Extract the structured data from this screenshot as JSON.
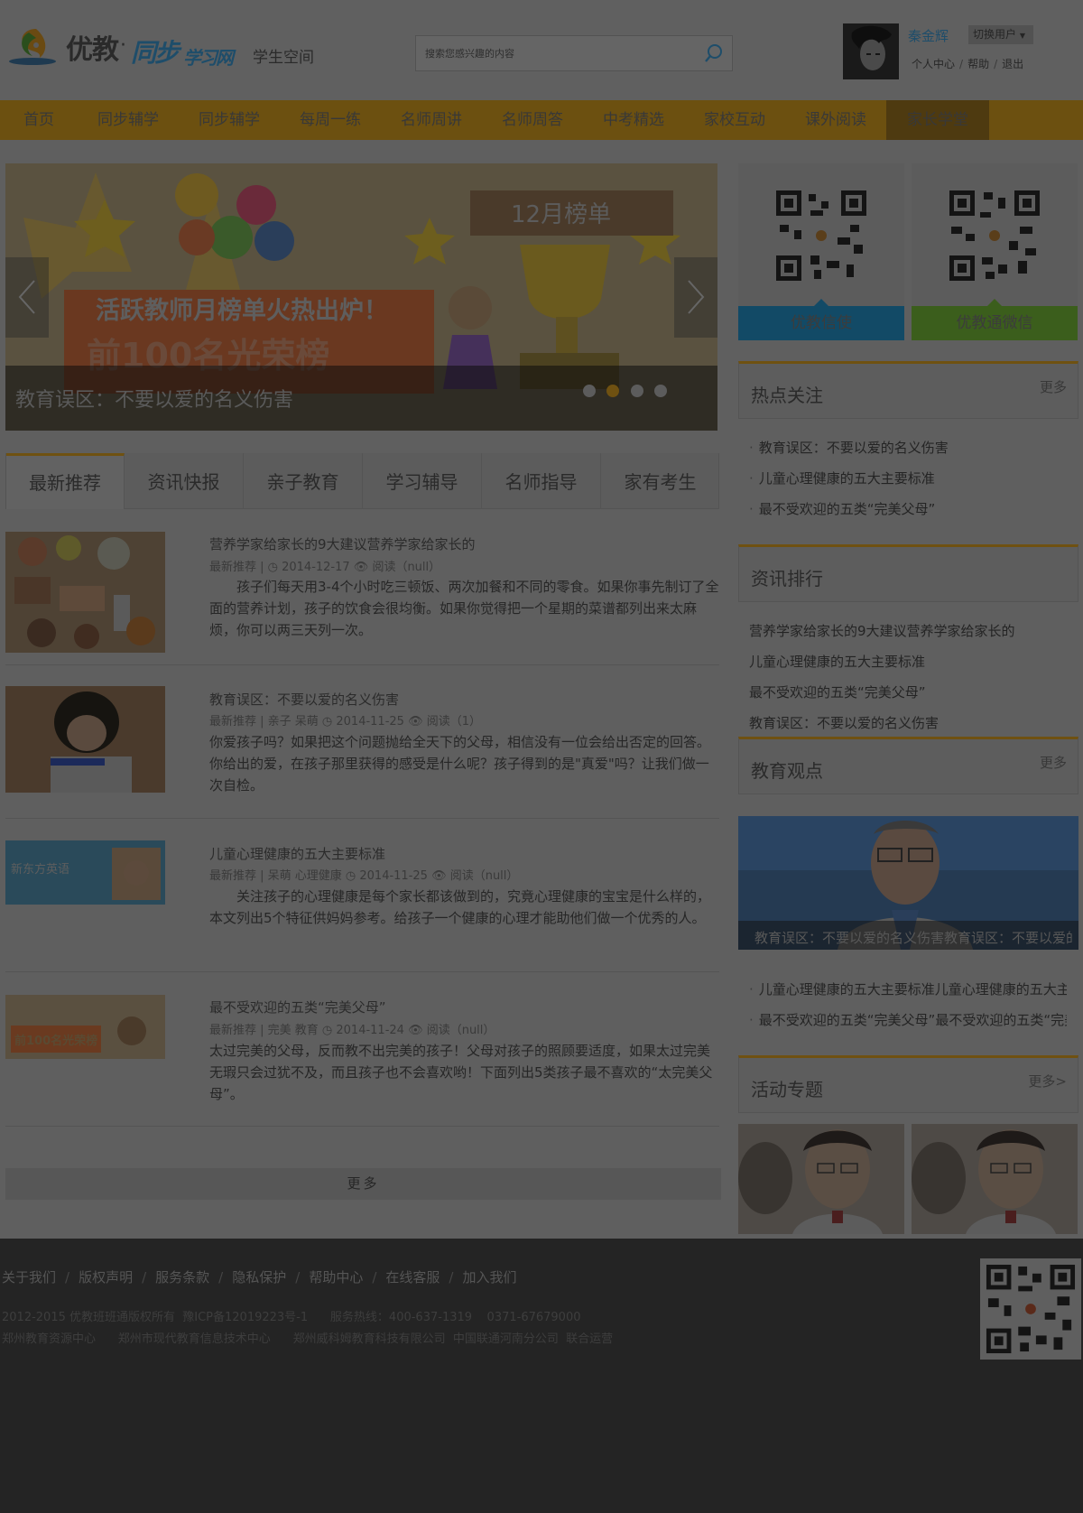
{
  "header": {
    "logo_youjiao": "优教",
    "logo_dot": "·",
    "logo_tongbu": "同步",
    "logo_xuexi": "学习网",
    "space_label": "学生空间",
    "search_placeholder": "搜索您感兴趣的内容",
    "username": "秦金辉",
    "switch_user": "切换用户",
    "user_links": [
      "个人中心",
      "帮助",
      "退出"
    ]
  },
  "nav": {
    "items": [
      "首页",
      "同步辅学",
      "同步辅学",
      "每周一练",
      "名师周讲",
      "名师周答",
      "中考精选",
      "家校互动",
      "课外阅读",
      "家长学堂"
    ],
    "active_index": 9
  },
  "banner": {
    "caption": "教育误区：不要以爱的名义伤害",
    "image_text_board": "12月榜单",
    "image_text_slogan": "活跃教师月榜单火热出炉！",
    "image_text_big": "前100名光荣榜",
    "dots_total": 4,
    "active_dot": 1
  },
  "tabs": [
    "最新推荐",
    "资讯快报",
    "亲子教育",
    "学习辅导",
    "名师指导",
    "家有考生"
  ],
  "articles": [
    {
      "title": "营养学家给家长的9大建议营养学家给家长的",
      "meta": "最新推荐 | ◷ 2014-12-17 👁 阅读（null）",
      "desc": "　　孩子们每天用3-4个小时吃三顿饭、两次加餐和不同的零食。如果你事先制订了全面的营养计划，孩子的饮食会很均衡。如果你觉得把一个星期的菜谱都列出来太麻烦，你可以两三天列一次。"
    },
    {
      "title": "教育误区：不要以爱的名义伤害",
      "meta": "最新推荐 | 亲子 呆萌 ◷ 2014-11-25 👁 阅读（1）",
      "desc": "你爱孩子吗？如果把这个问题抛给全天下的父母，相信没有一位会给出否定的回答。你给出的爱，在孩子那里获得的感受是什么呢？孩子得到的是\"真爱\"吗？让我们做一次自检。"
    },
    {
      "title": "儿童心理健康的五大主要标准",
      "meta": "最新推荐 | 呆萌 心理健康 ◷ 2014-11-25 👁 阅读（null）",
      "desc": "　　关注孩子的心理健康是每个家长都该做到的，究竟心理健康的宝宝是什么样的，本文列出5个特征供妈妈参考。给孩子一个健康的心理才能助他们做一个优秀的人。",
      "img_text": "新东方英语"
    },
    {
      "title": "最不受欢迎的五类“完美父母”",
      "meta": "最新推荐 | 完美 教育 ◷ 2014-11-24 👁 阅读（null）",
      "desc": "太过完美的父母，反而教不出完美的孩子！父母对孩子的照顾要适度，如果太过完美无瑕只会过犹不及，而且孩子也不会喜欢哟！下面列出5类孩子最不喜欢的“太完美父母”。",
      "img_text": "前100名光荣榜"
    }
  ],
  "more_button": "更多",
  "sidebar": {
    "qr_panels": [
      "优教信使",
      "优教通微信"
    ],
    "hot": {
      "title": "热点关注",
      "more": "更多",
      "items": [
        "教育误区：不要以爱的名义伤害",
        "儿童心理健康的五大主要标准",
        "最不受欢迎的五类“完美父母”"
      ]
    },
    "ranking": {
      "title": "资讯排行",
      "items": [
        "营养学家给家长的9大建议营养学家给家长的",
        "儿童心理健康的五大主要标准",
        "最不受欢迎的五类“完美父母”",
        "教育误区：不要以爱的名义伤害"
      ]
    },
    "opinion": {
      "title": "教育观点",
      "more": "更多",
      "caption": "教育误区：不要以爱的名义伤害教育误区：不要以爱的名义伤害",
      "items": [
        "儿童心理健康的五大主要标准儿童心理健康的五大主要标准",
        "最不受欢迎的五类“完美父母”最不受欢迎的五类“完美父母”"
      ]
    },
    "topics": {
      "title": "活动专题",
      "more": "更多>"
    }
  },
  "footer": {
    "links": [
      "关于我们",
      "版权声明",
      "服务条款",
      "隐私保护",
      "帮助中心",
      "在线客服",
      "加入我们"
    ],
    "copyright": "2012-2015 优教班班通版权所有  豫ICP备12019223号-1      服务热线：400-637-1319    0371-67679000",
    "orgs": "郑州教育资源中心      郑州市现代教育信息技术中心      郑州威科姆教育科技有限公司  中国联通河南分公司  联合运营"
  },
  "colors": {
    "accent": "#6f5111",
    "qr_blue": "#124a66",
    "qr_green": "#3b5e1c",
    "link_blue": "#1e4d6a"
  }
}
